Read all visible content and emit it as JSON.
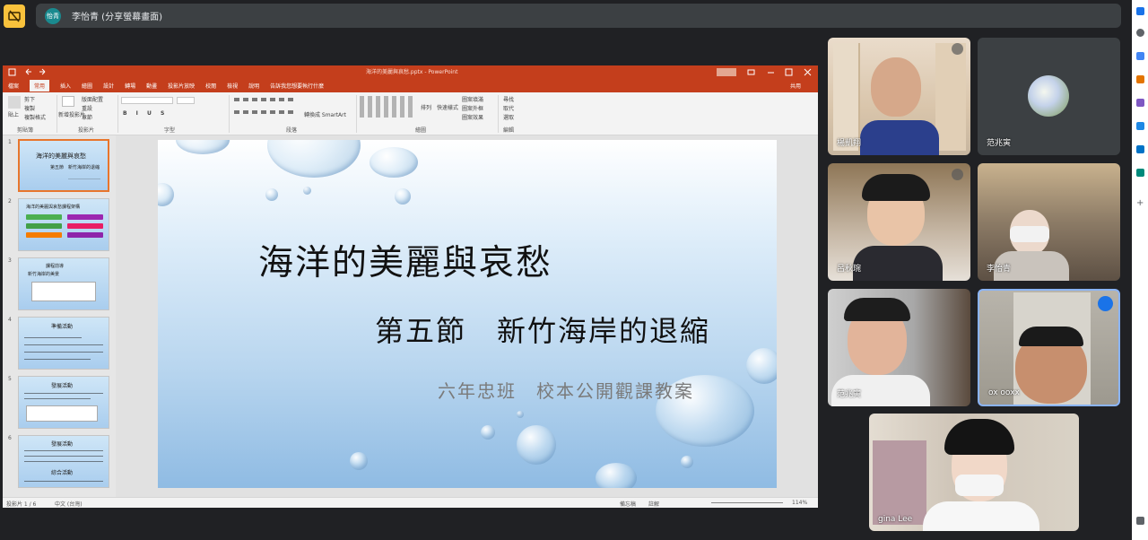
{
  "meet": {
    "presenter_avatar": "怡青",
    "share_label": "李怡青 (分享螢幕畫面)"
  },
  "ppt": {
    "window_title": "海洋的美麗與哀愁.pptx - PowerPoint",
    "tabs": [
      "檔案",
      "常用",
      "插入",
      "繪圖",
      "設計",
      "轉場",
      "動畫",
      "投影片放映",
      "校閱",
      "檢視",
      "說明",
      "告訴我您想要執行什麼"
    ],
    "active_tab": "常用",
    "ribbon_groups": [
      "剪貼簿",
      "投影片",
      "字型",
      "段落",
      "繪圖",
      "編輯"
    ],
    "ribbon_items": {
      "paste": "貼上",
      "cut": "剪下",
      "copy": "複製",
      "format_painter": "複製格式",
      "new_slide": "新增投影片",
      "layout": "版面配置",
      "reset": "重設",
      "section": "章節",
      "arrange": "排列",
      "quick_styles": "快速樣式",
      "shape_fill": "圖案填滿",
      "shape_outline": "圖案外框",
      "shape_effects": "圖案效果",
      "find": "尋找",
      "replace": "取代",
      "select": "選取",
      "smartart": "轉換成 SmartArt",
      "share": "共用"
    },
    "slide_numbers": [
      "1",
      "2",
      "3",
      "4",
      "5",
      "6"
    ],
    "slide": {
      "title": "海洋的美麗與哀愁",
      "subtitle": "第五節　新竹海岸的退縮",
      "caption": "六年忠班　校本公開觀課教案"
    },
    "thumbs": [
      {
        "title": "海洋的美麗與哀愁",
        "line2": "第五節　新竹海岸的退縮"
      },
      {
        "title": "海洋的美麗與哀愁課程架構"
      },
      {
        "title": "課程前導",
        "line2": "新竹海岸的美景"
      },
      {
        "title": "準備活動"
      },
      {
        "title": "發展活動"
      },
      {
        "title": "發展活動",
        "line2": "綜合活動"
      }
    ],
    "status": {
      "slide_of": "投影片 1 / 6",
      "language": "中文 (台灣)",
      "notes": "備忘稿",
      "comments": "註解",
      "zoom": "114%"
    }
  },
  "participants": [
    {
      "name": "楊凱翔"
    },
    {
      "name": "范兆寅"
    },
    {
      "name": "呂秋琬"
    },
    {
      "name": "李怡青"
    },
    {
      "name": "范兆寅"
    },
    {
      "name": "ox ooxx"
    },
    {
      "name": "gina Lee"
    }
  ]
}
